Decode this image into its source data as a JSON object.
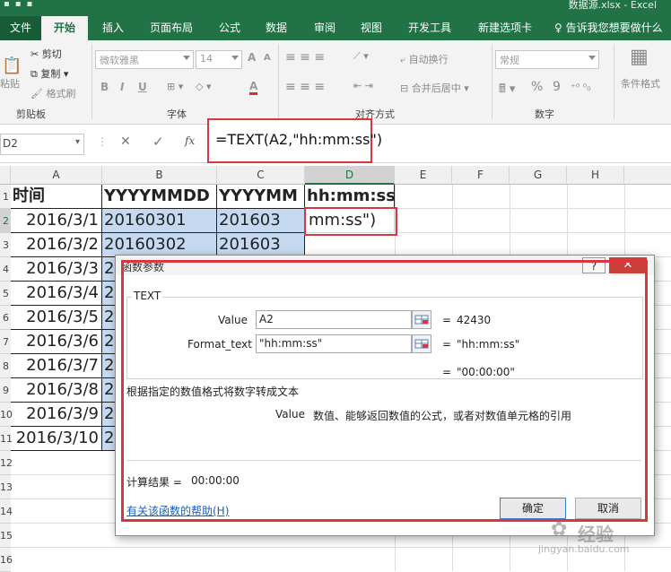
{
  "window": {
    "title": "数据源.xlsx - Excel"
  },
  "tabs": [
    "文件",
    "开始",
    "插入",
    "页面布局",
    "公式",
    "数据",
    "审阅",
    "视图",
    "开发工具",
    "新建选项卡"
  ],
  "tell_me": "告诉我您想要做什么",
  "ribbon": {
    "cut": "剪切",
    "copy": "复制",
    "format_painter": "格式刷",
    "paste": "粘贴",
    "font_name": "微软雅黑",
    "font_size": "14",
    "wrap_text": "自动换行",
    "merge_center": "合并后居中",
    "number_format": "常规",
    "percent": "%",
    "comma": "9",
    "cond_format": "条件格式",
    "bold": "B",
    "italic": "I",
    "underline": "U",
    "font_color": "A",
    "grow_font": "A",
    "groups": {
      "clipboard": "剪贴板",
      "font": "字体",
      "alignment": "对齐方式",
      "number": "数字"
    }
  },
  "formula_bar": {
    "name_box": "D2",
    "formula": "=TEXT(A2,\"hh:mm:ss\")",
    "fx": "fx"
  },
  "columns": [
    "A",
    "B",
    "C",
    "D",
    "E",
    "F",
    "G",
    "H"
  ],
  "rows": [
    "1",
    "2",
    "3",
    "4",
    "5",
    "6",
    "7",
    "8",
    "9",
    "10",
    "11",
    "12",
    "13",
    "14",
    "15",
    "16"
  ],
  "table": {
    "headers": [
      "时间",
      "YYYYMMDD",
      "YYYYMM",
      "hh:mm:ss"
    ],
    "col_a": [
      "2016/3/1",
      "2016/3/2",
      "2016/3/3",
      "2016/3/4",
      "2016/3/5",
      "2016/3/6",
      "2016/3/7",
      "2016/3/8",
      "2016/3/9",
      "2016/3/10"
    ],
    "col_b": [
      "20160301",
      "20160302",
      "2",
      "2",
      "2",
      "2",
      "2",
      "2",
      "2",
      "2"
    ],
    "col_c": [
      "201603",
      "201603"
    ],
    "d2": "mm:ss\")"
  },
  "dialog": {
    "title": "函数参数",
    "func": "TEXT",
    "arg1_label": "Value",
    "arg1_value": "A2",
    "arg1_result": "42430",
    "arg2_label": "Format_text",
    "arg2_value": "\"hh:mm:ss\"",
    "arg2_result": "\"hh:mm:ss\"",
    "equals": "=",
    "formula_result": "\"00:00:00\"",
    "description": "根据指定的数值格式将数字转成文本",
    "arg_desc_name": "Value",
    "arg_desc_text": "数值、能够返回数值的公式，或者对数值单元格的引用",
    "calc_result_label": "计算结果 =",
    "calc_result_value": "00:00:00",
    "help_link": "有关该函数的帮助(H)",
    "ok": "确定",
    "cancel": "取消",
    "help_btn": "?"
  },
  "watermark": {
    "text": "经验",
    "url": "jingyan.baidu.com"
  },
  "colors": {
    "excel_green": "#217346",
    "highlight_red": "#d9363e",
    "selection_blue": "#c5daf0"
  }
}
